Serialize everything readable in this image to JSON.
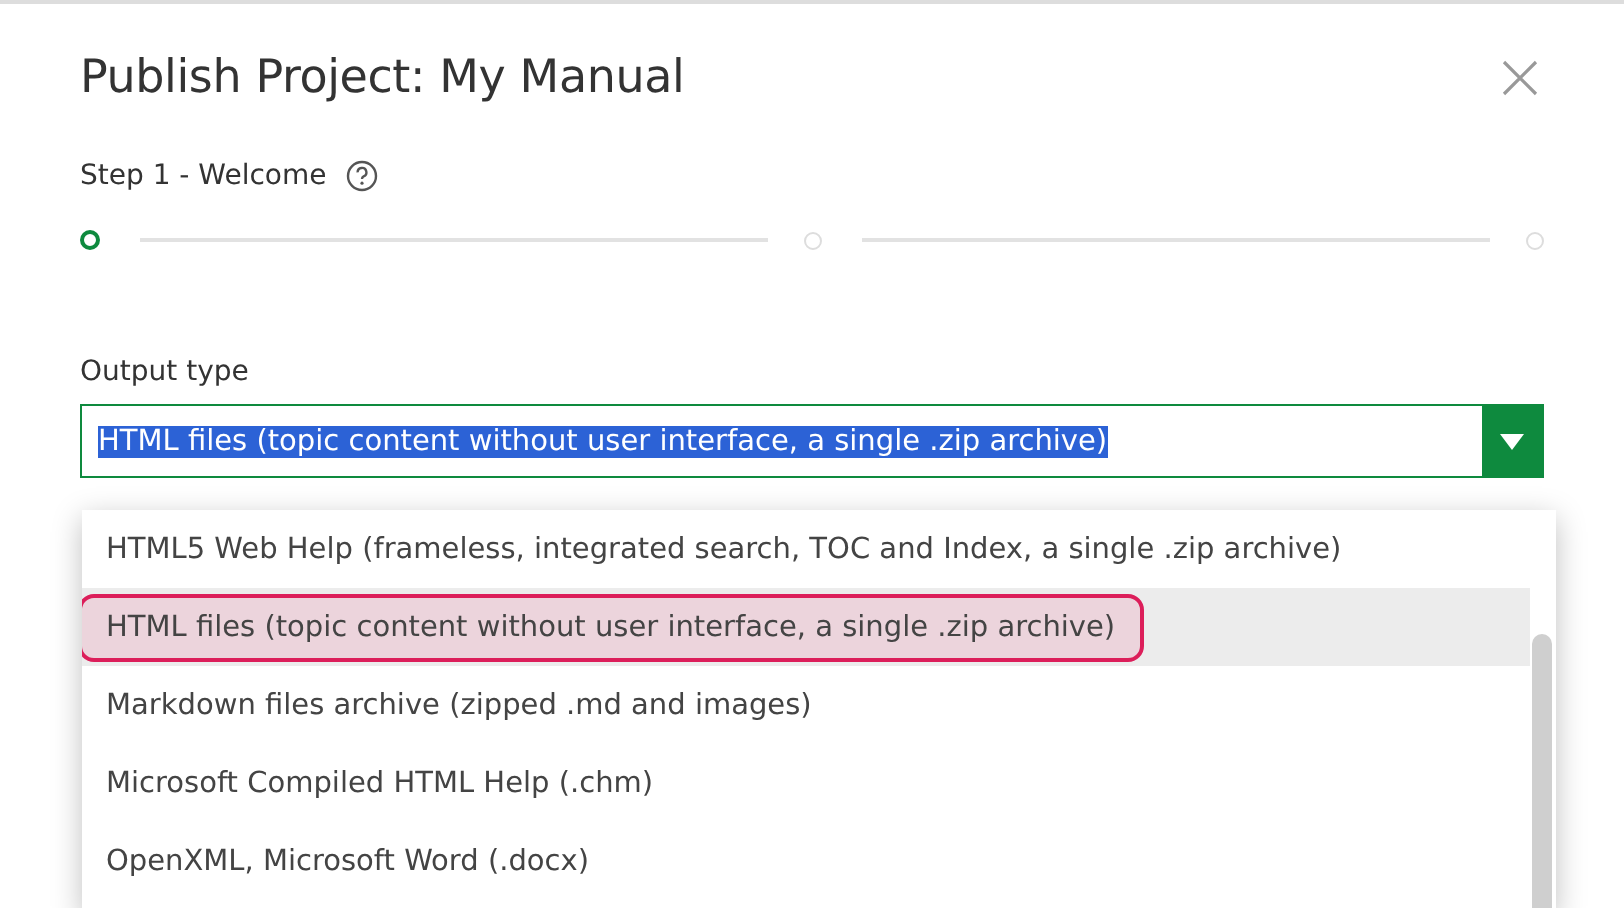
{
  "dialog": {
    "title": "Publish Project: My Manual"
  },
  "step": {
    "label": "Step 1 - Welcome"
  },
  "steps": [
    {
      "selected": true
    },
    {
      "selected": false
    },
    {
      "selected": false
    }
  ],
  "output_type": {
    "label": "Output type",
    "value": "HTML files (topic content without user interface, a single .zip archive)",
    "expanded": true
  },
  "options": [
    {
      "label": "HTML5 Web Help (frameless, integrated search, TOC and Index, a single .zip archive)",
      "selected": false
    },
    {
      "label": "HTML files (topic content without user interface, a single .zip archive)",
      "selected": true
    },
    {
      "label": "Markdown files archive (zipped .md and images)",
      "selected": false
    },
    {
      "label": "Microsoft Compiled HTML Help (.chm)",
      "selected": false
    },
    {
      "label": "OpenXML, Microsoft Word (.docx)",
      "selected": false
    }
  ]
}
